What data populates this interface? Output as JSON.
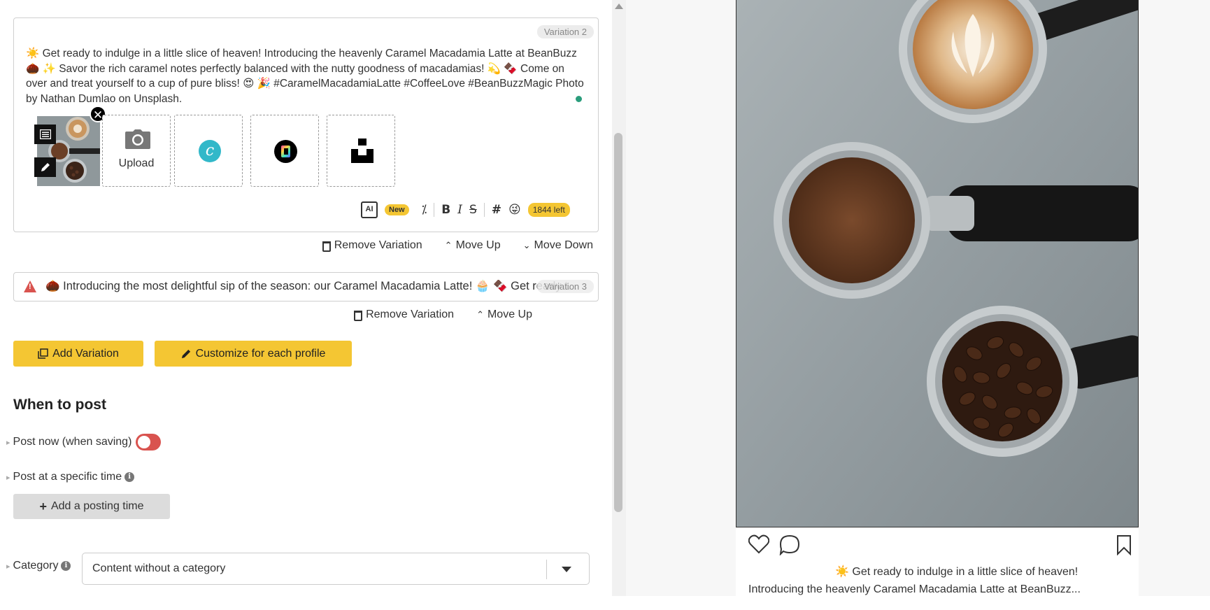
{
  "variation2": {
    "badge": "Variation 2",
    "text": "☀️ Get ready to indulge in a little slice of heaven! Introducing the heavenly Caramel Macadamia Latte at BeanBuzz 🌰 ✨ Savor the rich caramel notes perfectly balanced with the nutty goodness of macadamias! 💫 🍫 Come on over and treat yourself to a cup of pure bliss! 😍 🎉 #CaramelMacadamiaLatte #CoffeeLove #BeanBuzzMagic Photo by Nathan Dumlao on Unsplash.",
    "upload_label": "Upload",
    "canva_letter": "c",
    "new_badge": "New",
    "ai_label": "AI",
    "bold": "B",
    "italic": "I",
    "strike": "S",
    "hashtag": "#",
    "emoji": "😜",
    "chars_left": "1844 left",
    "magic_icon": "⁒"
  },
  "variation2_actions": {
    "remove": "Remove Variation",
    "move_up": "Move Up",
    "move_down": "Move Down"
  },
  "variation3": {
    "badge": "Variation 3",
    "preview_text": "🌰 Introducing the most delightful sip of the season: our Caramel Macadamia Latte! 🧁 🍫 Get ready t..."
  },
  "variation3_actions": {
    "remove": "Remove Variation",
    "move_up": "Move Up"
  },
  "buttons": {
    "add_variation": "Add Variation",
    "customize": "Customize for each profile"
  },
  "when_to_post": {
    "title": "When to post",
    "post_now": "Post now (when saving)",
    "specific_time": "Post at a specific time",
    "add_time": "Add a posting time"
  },
  "category": {
    "label": "Category",
    "value": "Content without a category"
  },
  "preview": {
    "caption_line1": "☀️ Get ready to indulge in a little slice of heaven!",
    "caption_line2": "Introducing the heavenly Caramel Macadamia Latte at BeanBuzz..."
  },
  "icons": {
    "close": "✕",
    "chevron_up": "⌃",
    "chevron_down": "⌄",
    "plus": "+",
    "info": "i",
    "warning": "!"
  },
  "colors": {
    "accent_yellow": "#f4c633",
    "toggle_red": "#d9534f",
    "status_green": "#2a9d7c"
  }
}
